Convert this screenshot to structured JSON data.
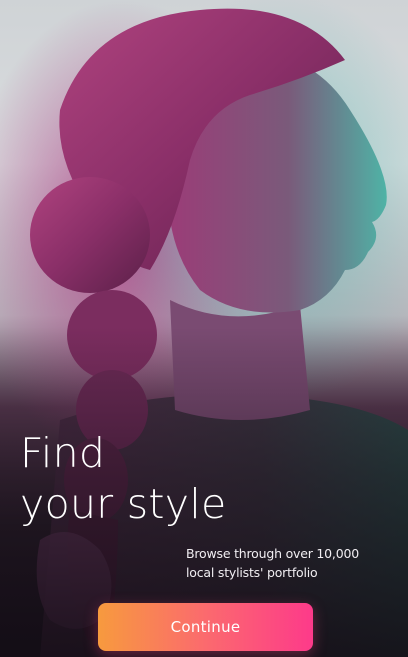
{
  "onboarding": {
    "headline": {
      "line1": "Find",
      "line2": "your style"
    },
    "subtext": {
      "line1": "Browse through over 10,000",
      "line2": "local stylists' portfolio"
    },
    "continue_label": "Continue"
  },
  "theme": {
    "button_gradient_start": "#f79a3e",
    "button_gradient_end": "#fd3a8a",
    "text_color": "#ffffff"
  }
}
